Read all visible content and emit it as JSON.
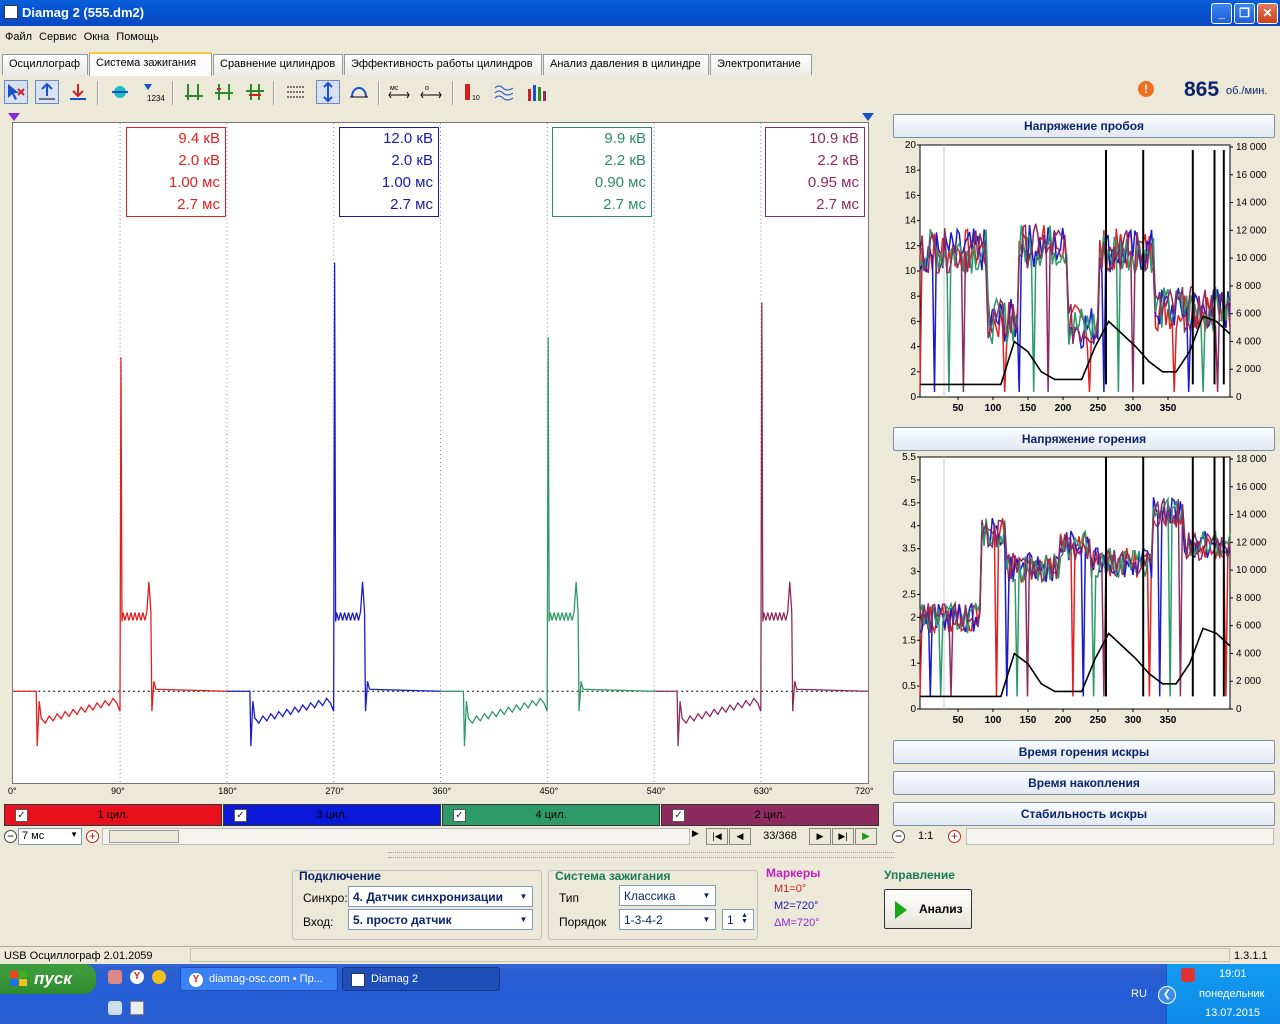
{
  "window": {
    "title": "Diamag 2 (555.dm2)"
  },
  "menu": [
    "Файл",
    "Сервис",
    "Окна",
    "Помощь"
  ],
  "tabs": [
    "Осциллограф",
    "Система зажигания",
    "Сравнение цилиндров",
    "Эффективность работы цилиндров",
    "Анализ давления в цилиндре",
    "Электропитание"
  ],
  "active_tab": 1,
  "rpm": {
    "value": "865",
    "unit": "об./мин."
  },
  "scope": {
    "x_ticks": [
      "0°",
      "90°",
      "180°",
      "270°",
      "360°",
      "450°",
      "540°",
      "630°",
      "720°"
    ],
    "measure_boxes": [
      {
        "lines": [
          "9.4 кВ",
          "2.0 кВ",
          "1.00 мс",
          "2.7 мс"
        ],
        "color": "#e02020"
      },
      {
        "lines": [
          "12.0 кВ",
          "2.0 кВ",
          "1.00 мс",
          "2.7 мс"
        ],
        "color": "#1a1aa8"
      },
      {
        "lines": [
          "9.9 кВ",
          "2.2 кВ",
          "0.90 мс",
          "2.7 мс"
        ],
        "color": "#2e8b6a"
      },
      {
        "lines": [
          "10.9 кВ",
          "2.2 кВ",
          "0.95 мс",
          "2.7 мс"
        ],
        "color": "#8e2b5e"
      }
    ],
    "legend": [
      {
        "label": "1 цил.",
        "color": "#e8101c"
      },
      {
        "label": "3 цил.",
        "color": "#0a18d8"
      },
      {
        "label": "4 цил.",
        "color": "#2e9a6a"
      },
      {
        "label": "2 цил.",
        "color": "#8e2b5e"
      }
    ],
    "time_scale": "7 мс",
    "frame": "33/368"
  },
  "right_panel": {
    "breakdown_title": "Напряжение пробоя",
    "breakdown_left_ticks": [
      "20",
      "18",
      "16",
      "14",
      "12",
      "10",
      "8",
      "6",
      "4",
      "2",
      "0"
    ],
    "breakdown_right_ticks": [
      "18 000",
      "16 000",
      "14 000",
      "12 000",
      "10 000",
      "8 000",
      "6 000",
      "4 000",
      "2 000",
      "0"
    ],
    "burning_title": "Напряжение горения",
    "burning_left_ticks": [
      "5.5",
      "5",
      "4.5",
      "4",
      "3.5",
      "3",
      "2.5",
      "2",
      "1.5",
      "1",
      "0.5",
      "0"
    ],
    "burning_right_ticks": [
      "18 000",
      "16 000",
      "14 000",
      "12 000",
      "10 000",
      "8 000",
      "6 000",
      "4 000",
      "2 000",
      "0"
    ],
    "x_ticks": [
      "50",
      "100",
      "150",
      "200",
      "250",
      "300",
      "350"
    ],
    "btn_spark_time": "Время горения искры",
    "btn_accum": "Время накопления",
    "btn_stability": "Стабильность искры",
    "zoom": "1:1"
  },
  "connection": {
    "title": "Подключение",
    "sync_label": "Синхро:",
    "sync_value": "4.  Датчик синхронизации",
    "input_label": "Вход:",
    "input_value": "5.  просто датчик"
  },
  "ignition": {
    "title": "Система зажигания",
    "type_label": "Тип",
    "type_value": "Классика",
    "order_label": "Порядок",
    "order_value": "1-3-4-2",
    "order_num": "1"
  },
  "markers": {
    "title": "Маркеры",
    "m1": "M1=0°",
    "m2": "M2=720°",
    "dm": "ΔM=720°"
  },
  "control": {
    "title": "Управление",
    "analyze": "Анализ"
  },
  "status": {
    "left": "USB Осциллограф  2.01.2059",
    "right": "1.3.1.1"
  },
  "taskbar": {
    "start": "пуск",
    "task1": "diamag-osc.com • Пр...",
    "task2": "Diamag 2",
    "lang": "RU",
    "time": "19:01",
    "day": "понедельник",
    "date": "13.07.2015"
  }
}
